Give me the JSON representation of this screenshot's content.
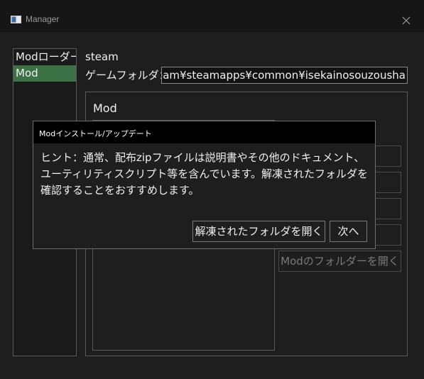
{
  "window": {
    "title": "Manager"
  },
  "sidebar": {
    "items": [
      {
        "label": "Modローダー",
        "selected": false
      },
      {
        "label": "Mod",
        "selected": true
      }
    ]
  },
  "main": {
    "steam_label": "steam",
    "game_folder_label": "ゲームフォルダ：",
    "game_folder_value": "eam¥steamapps¥common¥isekainosouzousha",
    "mod_group_title": "Mod",
    "open_mod_folder_label": "Modのフォルダーを開く"
  },
  "dialog": {
    "title": "Modインストール/アップデート",
    "message": "ヒント：通常、配布zipファイルは説明書やその他のドキュメント、ユーティリティスクリプト等を含んでいます。解凍されたフォルダを確認することをおすすめします。",
    "open_extracted_label": "解凍されたフォルダを開く",
    "next_label": "次へ"
  },
  "colors": {
    "selected_item": "#3d7246",
    "background": "#1e1e1e",
    "dialog_title_bg": "#000000"
  }
}
